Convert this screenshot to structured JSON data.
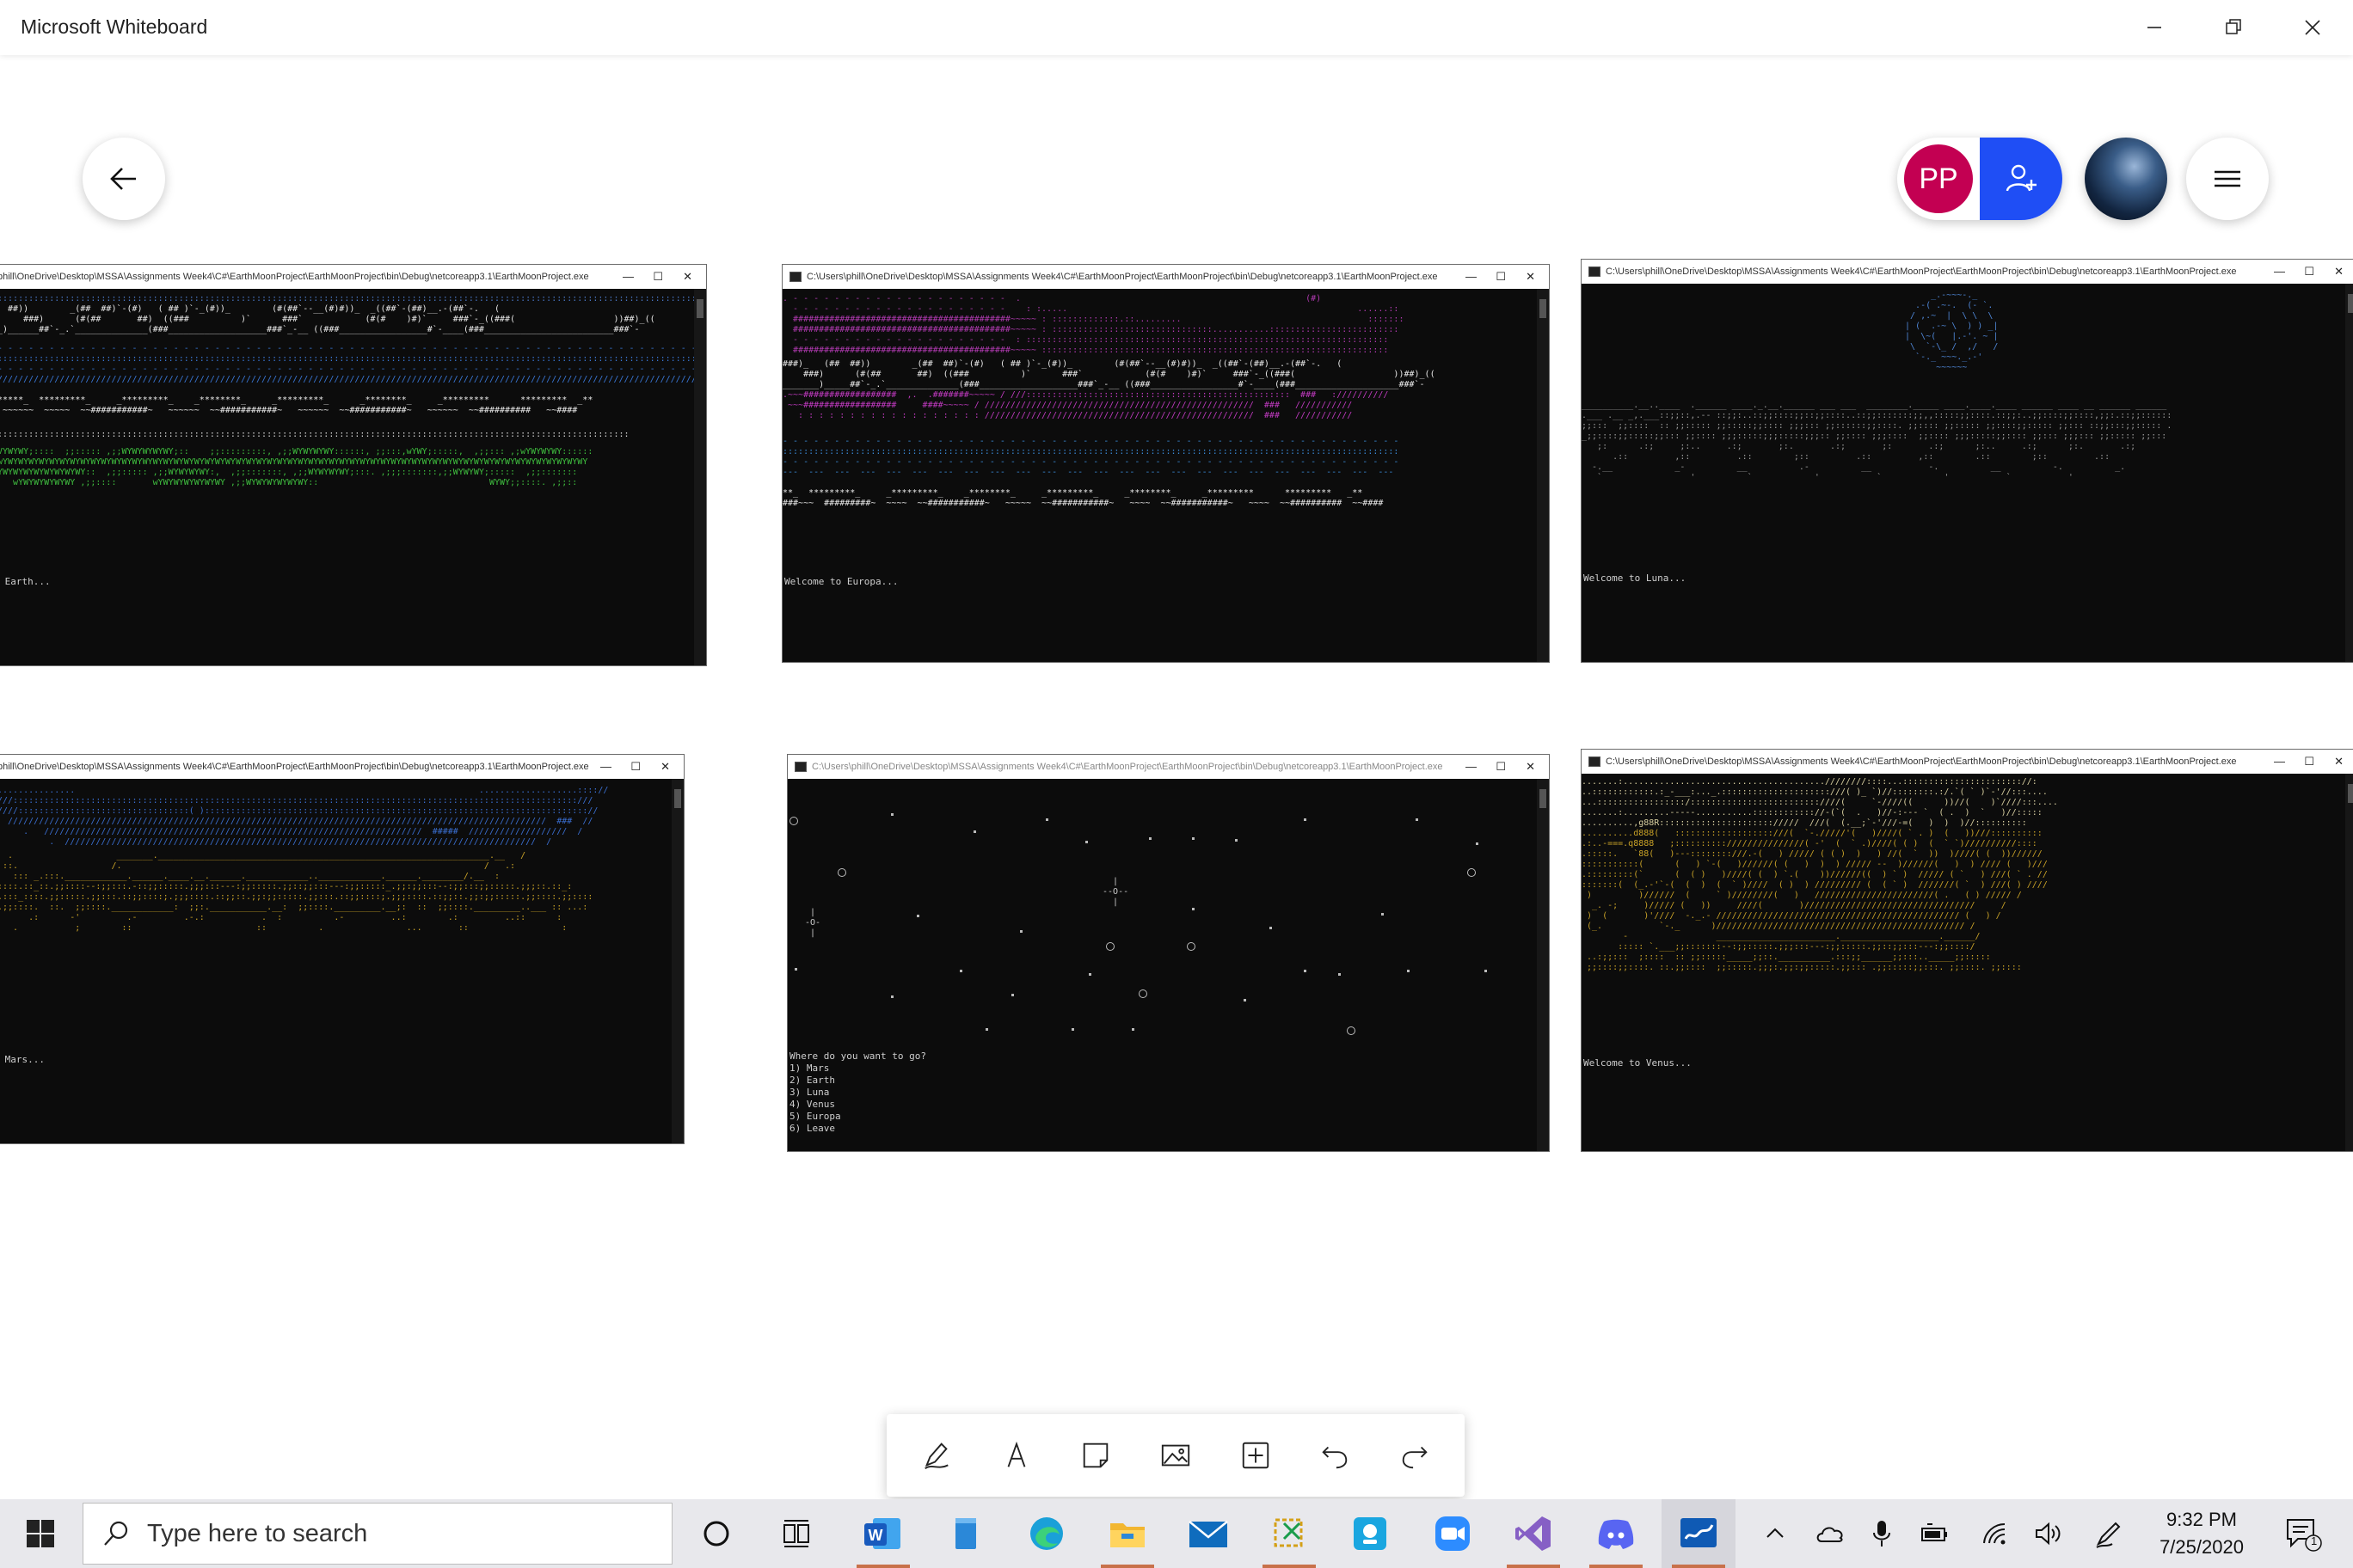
{
  "window": {
    "title": "Microsoft Whiteboard"
  },
  "avatar": {
    "initials": "PP",
    "color": "#c30052"
  },
  "accent": {
    "invite": "#1f4ef5",
    "taskbar_active": "#c8714a"
  },
  "icons": {
    "back": "arrow-left-icon",
    "invite": "add-person-icon",
    "menu": "hamburger-menu-icon",
    "minimize": "minimize-icon",
    "restore": "restore-icon",
    "close": "close-icon"
  },
  "console": {
    "path_full": "C:\\Users\\phill\\OneDrive\\Desktop\\MSSA\\Assignments Week4\\C#\\EarthMoonProject\\EarthMoonProject\\bin\\Debug\\netcoreapp3.1\\EarthMoonProject.exe",
    "path_cropped": "phill\\OneDrive\\Desktop\\MSSA\\Assignments Week4\\C#\\EarthMoonProject\\EarthMoonProject\\bin\\Debug\\netcoreapp3.1\\EarthMoonProject.exe",
    "ctl_min": "—",
    "ctl_max": "☐",
    "ctl_close": "✕"
  },
  "screens": {
    "earth": {
      "message": " Earth..."
    },
    "europa": {
      "message": "Welcome to Europa..."
    },
    "luna": {
      "message": "Welcome to Luna..."
    },
    "mars": {
      "message": " Mars..."
    },
    "menu": {
      "prompt": "Where do you want to go?",
      "options": [
        "1) Mars",
        "2) Earth",
        "3) Luna",
        "4) Venus",
        "5) Europa",
        "6) Leave"
      ]
    },
    "venus": {
      "message": "Welcome to Venus..."
    }
  },
  "toolbar": {
    "tools": [
      "pen-icon",
      "text-icon",
      "sticky-note-icon",
      "image-icon",
      "insert-icon",
      "undo-icon",
      "redo-icon"
    ]
  },
  "taskbar": {
    "search_placeholder": "Type here to search",
    "apps": [
      "cortana-icon",
      "task-view-icon",
      "word-icon",
      "notepad-icon",
      "edge-icon",
      "file-explorer-icon",
      "mail-icon",
      "snip-icon",
      "teams-icon",
      "zoom-icon",
      "visual-studio-icon",
      "discord-icon",
      "whiteboard-icon"
    ],
    "time": "9:32 PM",
    "date": "7/25/2020",
    "notification_count": "1"
  }
}
